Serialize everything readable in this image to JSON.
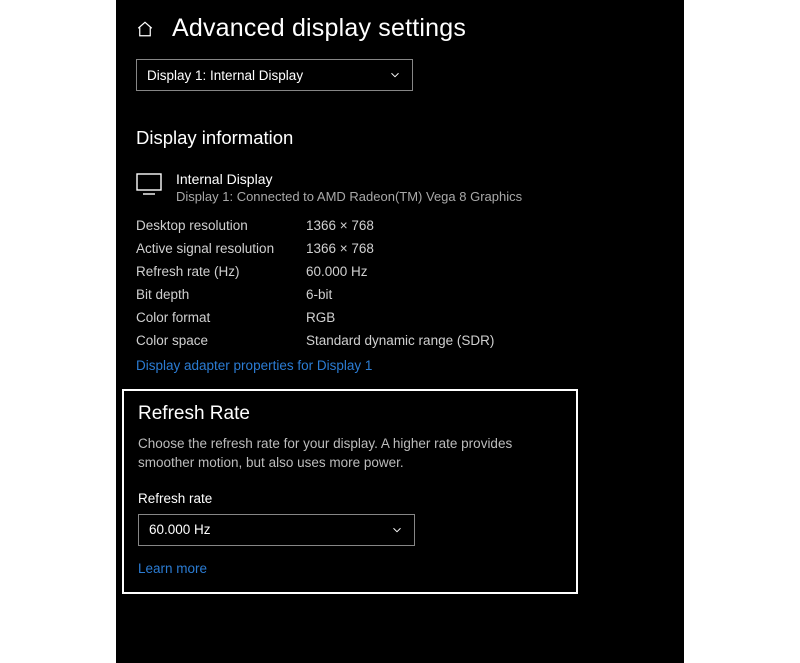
{
  "header": {
    "title": "Advanced display settings"
  },
  "displaySelect": {
    "value": "Display 1: Internal Display"
  },
  "infoSection": {
    "heading": "Display information",
    "displayName": "Internal Display",
    "displaySub": "Display 1: Connected to AMD Radeon(TM) Vega 8 Graphics",
    "rows": [
      {
        "label": "Desktop resolution",
        "value": "1366 × 768"
      },
      {
        "label": "Active signal resolution",
        "value": "1366 × 768"
      },
      {
        "label": "Refresh rate (Hz)",
        "value": "60.000 Hz"
      },
      {
        "label": "Bit depth",
        "value": "6-bit"
      },
      {
        "label": "Color format",
        "value": "RGB"
      },
      {
        "label": "Color space",
        "value": "Standard dynamic range (SDR)"
      }
    ],
    "adapterLink": "Display adapter properties for Display 1"
  },
  "refreshSection": {
    "heading": "Refresh Rate",
    "description": "Choose the refresh rate for your display. A higher rate provides smoother motion, but also uses more power.",
    "label": "Refresh rate",
    "value": "60.000 Hz",
    "learnMore": "Learn more"
  }
}
